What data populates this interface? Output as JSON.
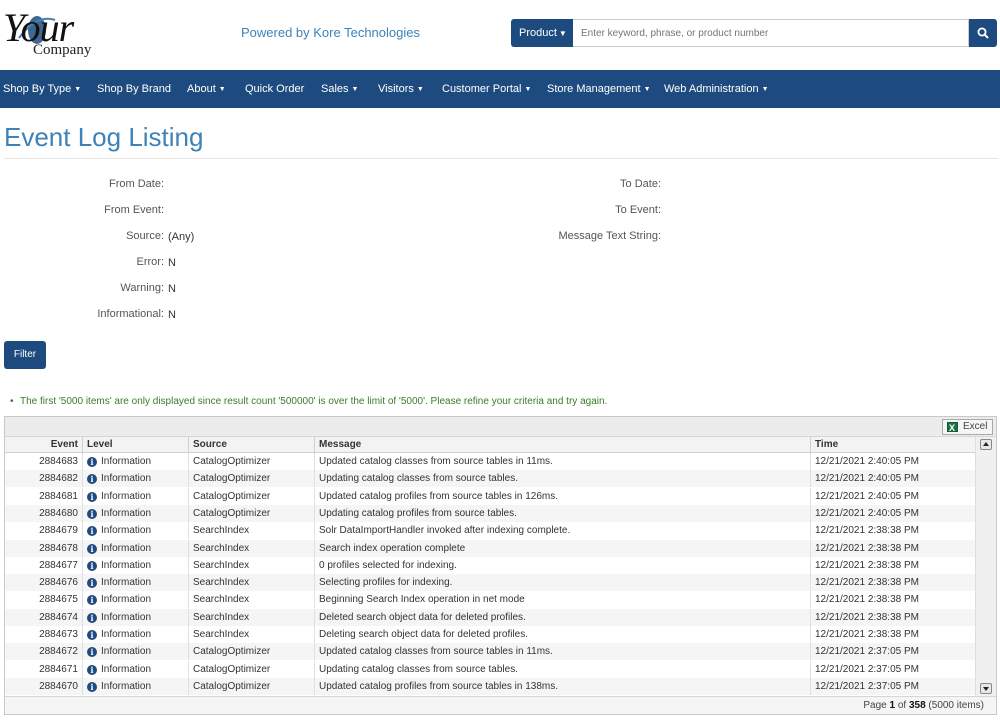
{
  "logo": {
    "word1": "Your",
    "word2": "Company"
  },
  "header": {
    "powered_by": "Powered by Kore Technologies",
    "search": {
      "scope_label": "Product",
      "placeholder": "Enter keyword, phrase, or product number"
    }
  },
  "nav": {
    "items": [
      {
        "label": "Shop By Type",
        "dropdown": true
      },
      {
        "label": "Shop By Brand",
        "dropdown": false
      },
      {
        "label": "About",
        "dropdown": true
      },
      {
        "label": "Quick Order",
        "dropdown": false
      },
      {
        "label": "Sales",
        "dropdown": true
      },
      {
        "label": "Visitors",
        "dropdown": true
      },
      {
        "label": "Customer Portal",
        "dropdown": true
      },
      {
        "label": "Store Management",
        "dropdown": true
      },
      {
        "label": "Web Administration",
        "dropdown": true
      }
    ]
  },
  "page": {
    "title": "Event Log Listing"
  },
  "form": {
    "from_date_label": "From Date:",
    "from_event_label": "From Event:",
    "source_label": "Source:",
    "source_value": "(Any)",
    "error_label": "Error:",
    "error_value": "N",
    "warning_label": "Warning:",
    "warning_value": "N",
    "informational_label": "Informational:",
    "informational_value": "N",
    "to_date_label": "To Date:",
    "to_event_label": "To Event:",
    "message_label": "Message Text String:",
    "filter_button": "Filter"
  },
  "notice": "The first '5000 items' are only displayed since result count '500000' is over the limit of '5000'. Please refine your criteria and try again.",
  "grid": {
    "excel_label": "Excel",
    "columns": [
      "Event",
      "Level",
      "Source",
      "Message",
      "Time"
    ],
    "rows": [
      {
        "event": "2884683",
        "level": "Information",
        "source": "CatalogOptimizer",
        "message": "Updated catalog classes from source tables in 11ms.",
        "time": "12/21/2021 2:40:05 PM"
      },
      {
        "event": "2884682",
        "level": "Information",
        "source": "CatalogOptimizer",
        "message": "Updating catalog classes from source tables.",
        "time": "12/21/2021 2:40:05 PM"
      },
      {
        "event": "2884681",
        "level": "Information",
        "source": "CatalogOptimizer",
        "message": "Updated catalog profiles from source tables in 126ms.",
        "time": "12/21/2021 2:40:05 PM"
      },
      {
        "event": "2884680",
        "level": "Information",
        "source": "CatalogOptimizer",
        "message": "Updating catalog profiles from source tables.",
        "time": "12/21/2021 2:40:05 PM"
      },
      {
        "event": "2884679",
        "level": "Information",
        "source": "SearchIndex",
        "message": "Solr DataImportHandler invoked after indexing complete.",
        "time": "12/21/2021 2:38:38 PM"
      },
      {
        "event": "2884678",
        "level": "Information",
        "source": "SearchIndex",
        "message": "Search index operation complete",
        "time": "12/21/2021 2:38:38 PM"
      },
      {
        "event": "2884677",
        "level": "Information",
        "source": "SearchIndex",
        "message": "0 profiles selected for indexing.",
        "time": "12/21/2021 2:38:38 PM"
      },
      {
        "event": "2884676",
        "level": "Information",
        "source": "SearchIndex",
        "message": "Selecting profiles for indexing.",
        "time": "12/21/2021 2:38:38 PM"
      },
      {
        "event": "2884675",
        "level": "Information",
        "source": "SearchIndex",
        "message": "Beginning Search Index operation in net mode",
        "time": "12/21/2021 2:38:38 PM"
      },
      {
        "event": "2884674",
        "level": "Information",
        "source": "SearchIndex",
        "message": "Deleted search object data for deleted profiles.",
        "time": "12/21/2021 2:38:38 PM"
      },
      {
        "event": "2884673",
        "level": "Information",
        "source": "SearchIndex",
        "message": "Deleting search object data for deleted profiles.",
        "time": "12/21/2021 2:38:38 PM"
      },
      {
        "event": "2884672",
        "level": "Information",
        "source": "CatalogOptimizer",
        "message": "Updated catalog classes from source tables in 11ms.",
        "time": "12/21/2021 2:37:05 PM"
      },
      {
        "event": "2884671",
        "level": "Information",
        "source": "CatalogOptimizer",
        "message": "Updating catalog classes from source tables.",
        "time": "12/21/2021 2:37:05 PM"
      },
      {
        "event": "2884670",
        "level": "Information",
        "source": "CatalogOptimizer",
        "message": "Updated catalog profiles from source tables in 138ms.",
        "time": "12/21/2021 2:37:05 PM"
      }
    ],
    "pager": {
      "prefix": "Page",
      "current": "1",
      "of": "of",
      "total": "358",
      "items": "(5000 items)"
    }
  },
  "colors": {
    "brand_blue": "#1e4b7f",
    "link_blue": "#3d82b8",
    "notice_green": "#3c7a2b"
  }
}
